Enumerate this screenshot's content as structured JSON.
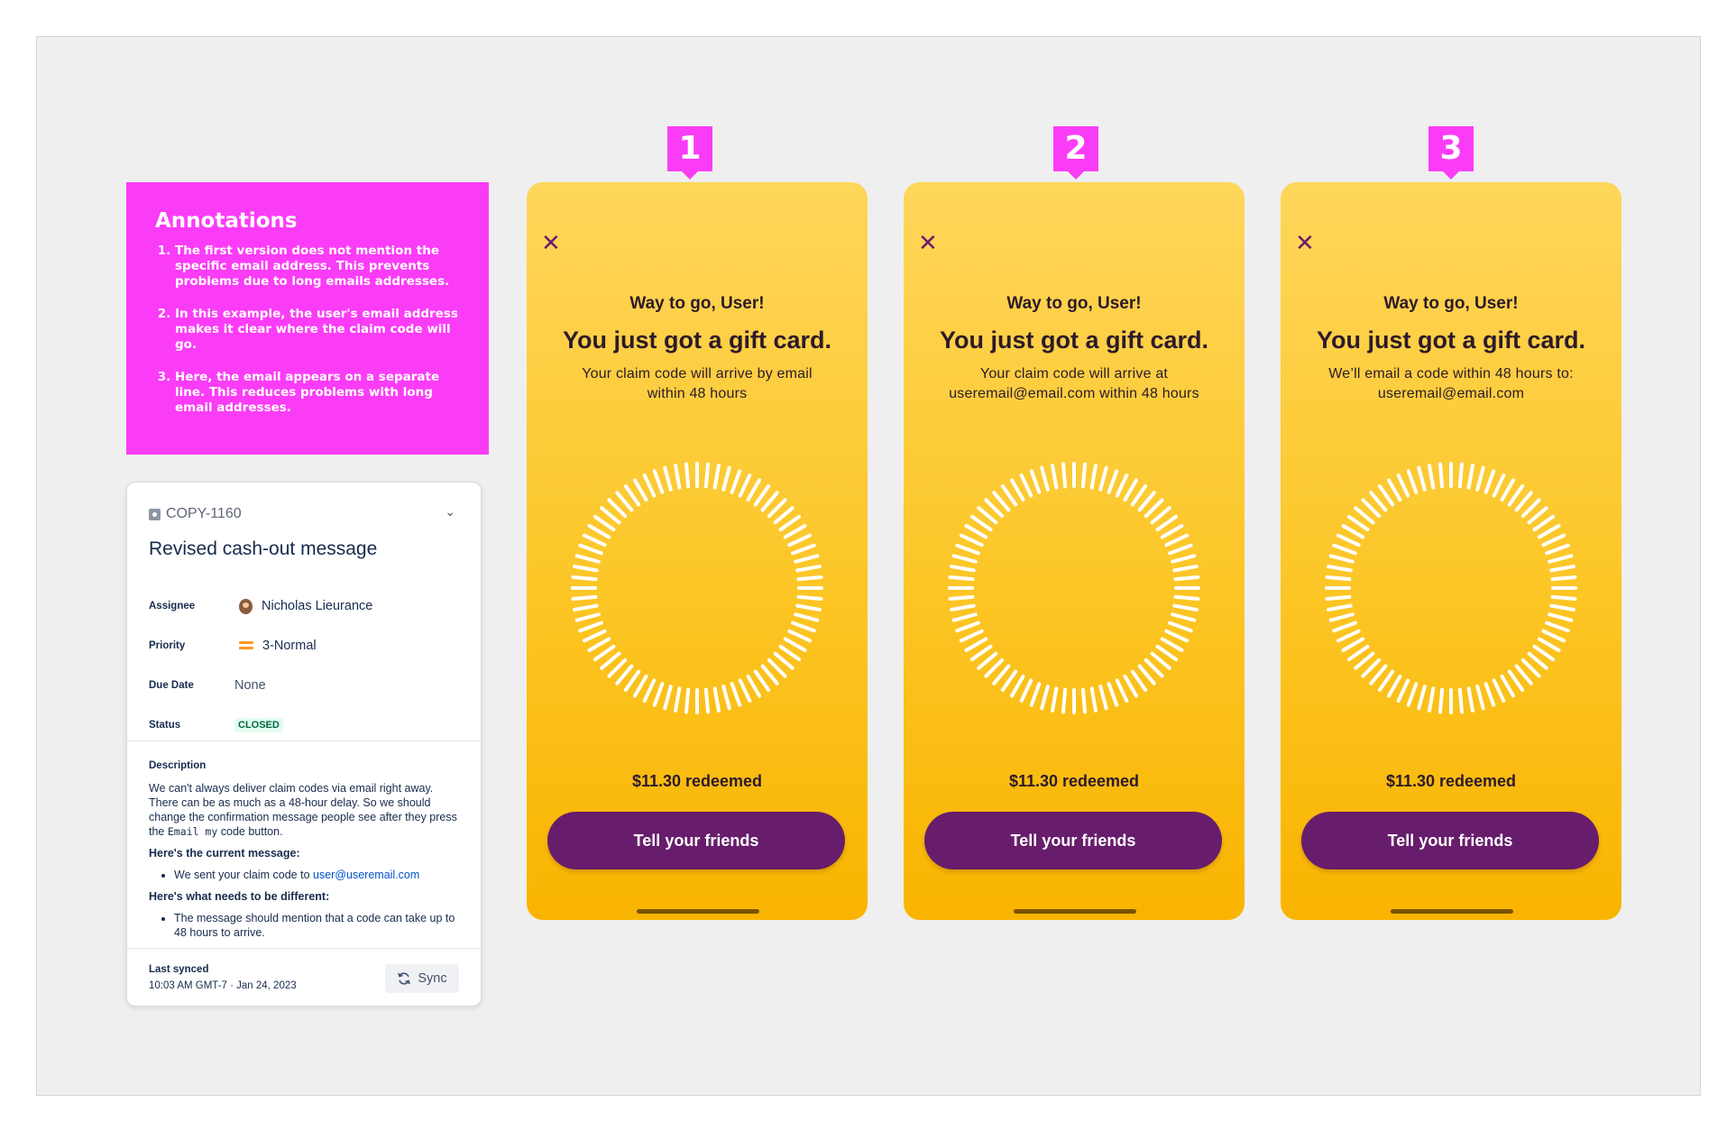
{
  "annotations": {
    "title": "Annotations",
    "items": [
      "The first version does not mention the specific email address. This prevents problems due to long emails addresses.",
      "In this example, the user's email address makes it clear where the claim code will go.",
      "Here, the email appears on a separate line. This reduces problems with long email addresses."
    ]
  },
  "ticket": {
    "key": "COPY-1160",
    "title": "Revised cash-out message",
    "fields": {
      "assignee_label": "Assignee",
      "assignee": "Nicholas Lieurance",
      "priority_label": "Priority",
      "priority": "3-Normal",
      "due_label": "Due Date",
      "due": "None",
      "status_label": "Status",
      "status": "CLOSED"
    },
    "description": {
      "heading": "Description",
      "intro_1": "We can't always deliver claim codes via email right away. There can be as much as a 48-hour delay. So we should change the confirmation message people see after they press the",
      "intro_code": "Email my",
      "intro_2": "code button.",
      "current_heading": "Here's the current message:",
      "current_text": "We sent your claim code to",
      "current_email": "user@useremail.com",
      "different_heading": "Here's what needs to be different:",
      "different_text": "The message should mention that a code can take up to 48 hours to arrive."
    },
    "sync": {
      "label": "Last synced",
      "time": "10:03 AM GMT-7 · Jan 24, 2023",
      "button": "Sync"
    }
  },
  "phones": [
    {
      "tag": "1",
      "greeting": "Way to go, User!",
      "headline": "You just got a gift card.",
      "sub_line1": "Your claim code will arrive by email",
      "sub_line2": "within 48 hours",
      "amount": "$11.30 redeemed",
      "cta": "Tell your friends"
    },
    {
      "tag": "2",
      "greeting": "Way to go, User!",
      "headline": "You just got a gift card.",
      "sub_line1": "Your claim code will arrive at",
      "sub_line2": "useremail@email.com within 48 hours",
      "amount": "$11.30 redeemed",
      "cta": "Tell your friends"
    },
    {
      "tag": "3",
      "greeting": "Way to go, User!",
      "headline": "You just got a gift card.",
      "sub_line1": "We’ll email a code within 48 hours to:",
      "sub_line2": "useremail@email.com",
      "amount": "$11.30 redeemed",
      "cta": "Tell your friends"
    }
  ],
  "icons": {
    "close": "close-icon",
    "sync": "refresh-icon",
    "chevron": "chevron-down-icon",
    "ring": "sunburst-ring"
  },
  "colors": {
    "annotation": "#fb3cf7",
    "phone_top": "#fed65b",
    "phone_bottom": "#f9b400",
    "cta": "#671d6b"
  }
}
